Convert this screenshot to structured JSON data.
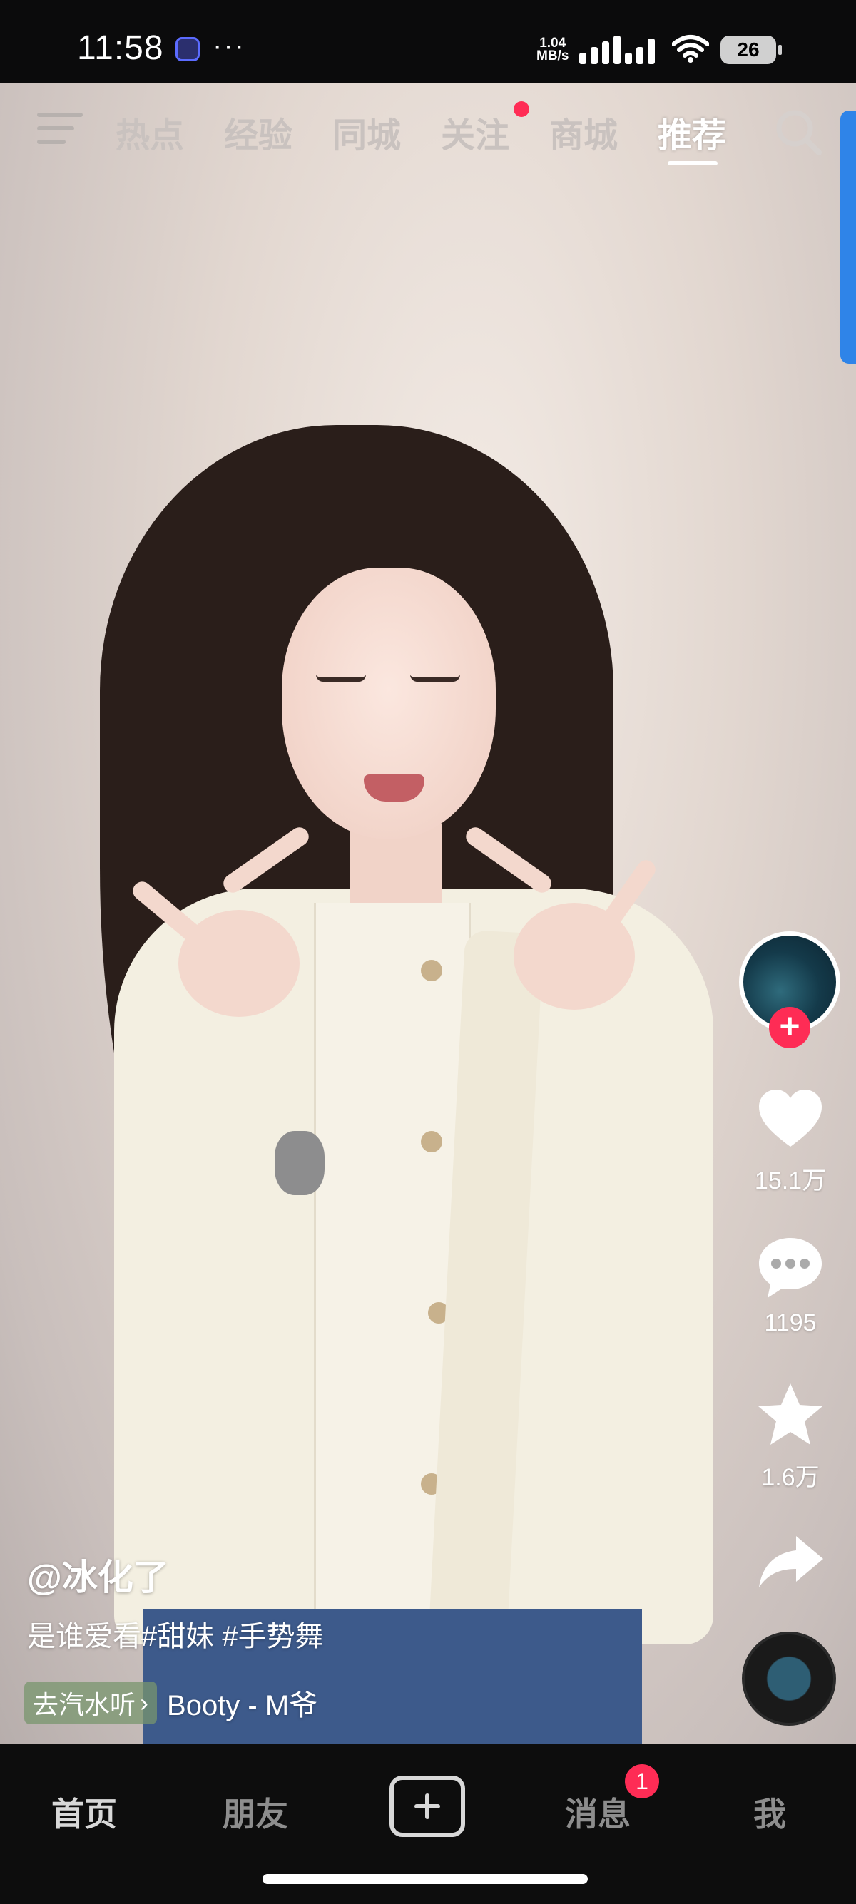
{
  "status_bar": {
    "time": "11:58",
    "more": "···",
    "net_speed_value": "1.04",
    "net_speed_unit": "MB/s",
    "battery": "26"
  },
  "top_tabs": [
    {
      "label": "热点",
      "active": false
    },
    {
      "label": "经验",
      "active": false
    },
    {
      "label": "同城",
      "active": false
    },
    {
      "label": "关注",
      "active": false,
      "has_dot": true
    },
    {
      "label": "商城",
      "active": false
    },
    {
      "label": "推荐",
      "active": true
    }
  ],
  "video": {
    "author": "@冰化了",
    "description": "是谁爱看#甜妹 #手势舞",
    "music_badge": "去汽水听",
    "music_badge_chevron": "›",
    "music_title": "Booty - M爷"
  },
  "actions": {
    "likes": "15.1万",
    "comments": "1195",
    "favorites": "1.6万",
    "follow_plus": "+"
  },
  "bottom_nav": [
    {
      "label": "首页",
      "active": true
    },
    {
      "label": "朋友",
      "active": false
    },
    {
      "label": "消息",
      "active": false,
      "badge": "1"
    },
    {
      "label": "我",
      "active": false
    }
  ],
  "icons": [
    "menu-icon",
    "search-icon",
    "heart-icon",
    "comment-icon",
    "star-icon",
    "share-icon",
    "music-disc-icon",
    "add-icon",
    "wifi-icon",
    "signal-icon"
  ],
  "colors": {
    "accent_red": "#fe2c55",
    "scroll_accent_blue": "#2f84e8",
    "music_badge_bg": "#7e9670"
  }
}
